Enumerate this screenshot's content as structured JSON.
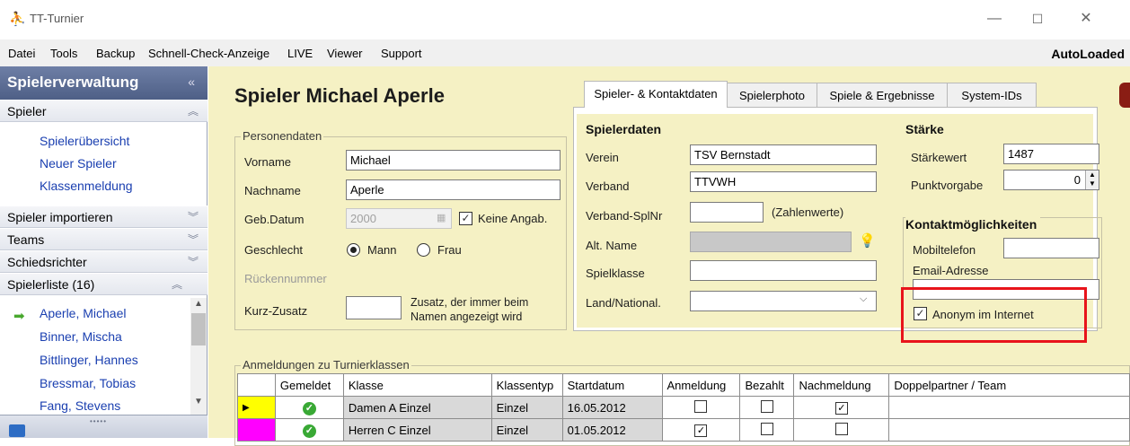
{
  "window": {
    "title": "TT-Turnier"
  },
  "menu": [
    "Datei",
    "Tools",
    "Backup",
    "Schnell-Check-Anzeige",
    "LIVE",
    "Viewer",
    "Support"
  ],
  "menu_status": "AutoLoaded",
  "sidebar": {
    "header": "Spielerverwaltung",
    "header_collapse": "«",
    "groups": {
      "spieler": "Spieler",
      "spieler_importieren": "Spieler importieren",
      "teams": "Teams",
      "schiedsrichter": "Schiedsrichter",
      "spielerliste": "Spielerliste (16)"
    },
    "links": [
      "Spielerübersicht",
      "Neuer Spieler",
      "Klassenmeldung"
    ],
    "players": [
      "Aperle, Michael",
      "Binner, Mischa",
      "Bittlinger, Hannes",
      "Bressmar, Tobias",
      "Fang, Stevens"
    ]
  },
  "page_title": "Spieler Michael Aperle",
  "personendaten": {
    "title": "Personendaten",
    "vorname_label": "Vorname",
    "vorname": "Michael",
    "nachname_label": "Nachname",
    "nachname": "Aperle",
    "gebdatum_label": "Geb.Datum",
    "gebdatum": "2000",
    "keine_angabe": "Keine Angab.",
    "geschlecht_label": "Geschlecht",
    "mann": "Mann",
    "frau": "Frau",
    "rueckennummer_label": "Rückennummer",
    "kurzzusatz_label": "Kurz-Zusatz",
    "kurzzusatz_hint_1": "Zusatz, der immer beim",
    "kurzzusatz_hint_2": "Namen angezeigt wird"
  },
  "tabs": [
    "Spieler- & Kontaktdaten",
    "Spielerphoto",
    "Spiele & Ergebnisse",
    "System-IDs"
  ],
  "spielerdaten": {
    "title": "Spielerdaten",
    "verein_label": "Verein",
    "verein": "TSV Bernstadt",
    "verband_label": "Verband",
    "verband": "TTVWH",
    "verband_splnr_label": "Verband-SplNr",
    "zahlenwerte": "(Zahlenwerte)",
    "alt_name_label": "Alt. Name",
    "spielklasse_label": "Spielklasse",
    "land_label": "Land/National."
  },
  "staerke": {
    "title": "Stärke",
    "staerkewert_label": "Stärkewert",
    "staerkewert": "1487",
    "punktvorgabe_label": "Punktvorgabe",
    "punktvorgabe": "0"
  },
  "kontakt": {
    "title": "Kontaktmöglichkeiten",
    "mobil_label": "Mobiltelefon",
    "email_label": "Email-Adresse",
    "anonym_label": "Anonym im Internet"
  },
  "anmeldungen": {
    "title": "Anmeldungen zu Turnierklassen",
    "columns": [
      "",
      "Gemeldet",
      "Klasse",
      "Klassentyp",
      "Startdatum",
      "Anmeldung",
      "Bezahlt",
      "Nachmeldung",
      "Doppelpartner / Team"
    ],
    "rows": [
      {
        "marker_color": "#ffff00",
        "klasse": "Damen A Einzel",
        "klassentyp": "Einzel",
        "startdatum": "16.05.2012",
        "anmeldung": false,
        "bezahlt": false,
        "nachmeldung": true
      },
      {
        "marker_color": "#ff00ff",
        "klasse": "Herren C Einzel",
        "klassentyp": "Einzel",
        "startdatum": "01.05.2012",
        "anmeldung": true,
        "bezahlt": false,
        "nachmeldung": false
      }
    ]
  }
}
